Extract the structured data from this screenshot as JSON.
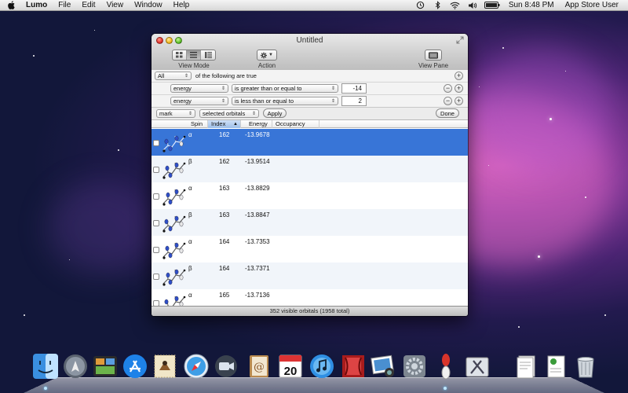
{
  "menubar": {
    "app_name": "Lumo",
    "items": [
      "File",
      "Edit",
      "View",
      "Window",
      "Help"
    ],
    "clock": "Sun 8:48 PM",
    "user": "App Store User"
  },
  "window": {
    "title": "Untitled",
    "toolbar": {
      "view_mode_label": "View Mode",
      "action_label": "Action",
      "view_pane_label": "View Pane"
    },
    "filter": {
      "match_value": "All",
      "match_suffix": "of the following are true",
      "rules": [
        {
          "field": "energy",
          "operator": "is greater than or equal to",
          "value": "-14"
        },
        {
          "field": "energy",
          "operator": "is less than or equal to",
          "value": "2"
        }
      ],
      "action_value": "mark",
      "target_value": "selected orbitals",
      "apply_label": "Apply",
      "done_label": "Done"
    },
    "table": {
      "columns": [
        "Spin",
        "Index",
        "Energy",
        "Occupancy"
      ],
      "sorted_column": "Index",
      "rows": [
        {
          "spin": "α",
          "index": "162",
          "energy": "-13.9678",
          "selected": true
        },
        {
          "spin": "β",
          "index": "162",
          "energy": "-13.9514",
          "selected": false
        },
        {
          "spin": "α",
          "index": "163",
          "energy": "-13.8829",
          "selected": false
        },
        {
          "spin": "β",
          "index": "163",
          "energy": "-13.8847",
          "selected": false
        },
        {
          "spin": "α",
          "index": "164",
          "energy": "-13.7353",
          "selected": false
        },
        {
          "spin": "β",
          "index": "164",
          "energy": "-13.7371",
          "selected": false
        },
        {
          "spin": "α",
          "index": "165",
          "energy": "-13.7136",
          "selected": false
        }
      ]
    },
    "status": "352 visible orbitals (1958 total)"
  },
  "dock": {
    "icons": [
      "finder-icon",
      "launchpad-icon",
      "mission-control-icon",
      "app-store-icon",
      "mail-stamp-icon",
      "safari-icon",
      "facetime-icon",
      "address-book-icon",
      "ical-icon",
      "itunes-icon",
      "photo-booth-icon",
      "iphoto-icon",
      "system-preferences-icon",
      "lumo-orbital-icon",
      "utilities-icon",
      "documents-stack-icon",
      "downloads-stack-icon",
      "trash-icon"
    ],
    "ical_day": "20"
  },
  "colors": {
    "selection": "#3875d7",
    "row_alt": "#f1f5fa",
    "sorted_header": "#9ebfe9"
  }
}
